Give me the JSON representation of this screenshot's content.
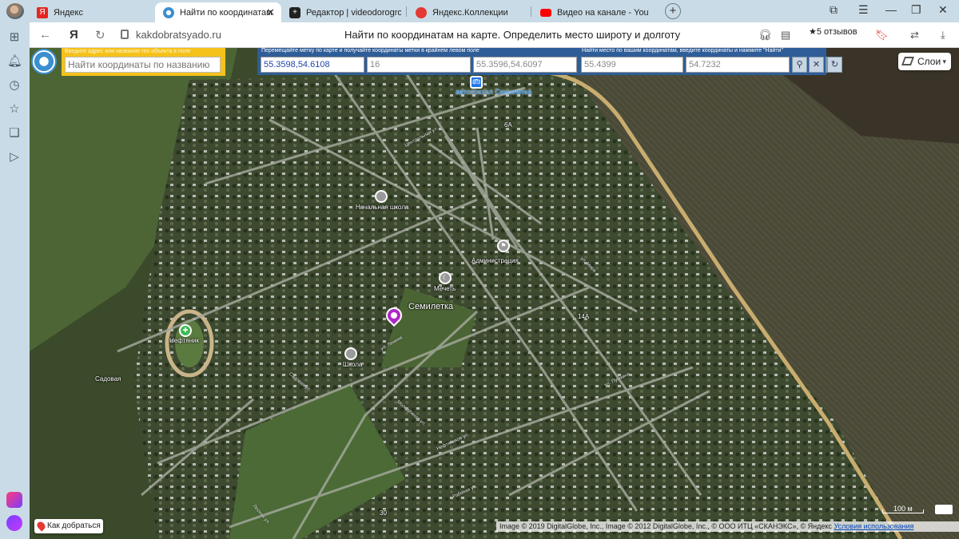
{
  "browser": {
    "tabs": [
      {
        "title": "Яндекс",
        "icon": "yandex-icon",
        "color": "#e52620"
      },
      {
        "title": "Найти по координатам",
        "icon": "globe-icon",
        "color": "#3b8fd0",
        "active": true
      },
      {
        "title": "Редактор | videodorogrosc",
        "icon": "editor-icon",
        "color": "#222222"
      },
      {
        "title": "Яндекс.Коллекции",
        "icon": "collections-icon",
        "color": "#e53935"
      },
      {
        "title": "Видео на канале - YouTube",
        "icon": "youtube-icon",
        "color": "#ff0000"
      }
    ],
    "url": "kakdobratsyado.ru",
    "page_title": "Найти по координатам на карте. Определить место широту и долготу",
    "reviews": "5 отзывов",
    "yandex_letter": "Я"
  },
  "app": {
    "search_hint": "Введите адрес или название гео объекта в поле",
    "search_placeholder": "Найти координаты по названию",
    "marker_caption": "Перемещайте метку по карте и получайте координаты метки в крайнем левом поле",
    "find_caption": "Найти место по вашим координатам, введите координаты и нажмите \"Найти\"",
    "marker_coords": "55.3598,54.6108",
    "zoom": "16",
    "corner_coords": "55.3596,54.6097",
    "lat_input": "55.4399",
    "lon_input": "54.7232",
    "layers_label": "Слои",
    "route_label": "Как добраться",
    "scale_label": "100 м",
    "copyright": "Image © 2019 DigitalGlobe, Inc., Image © 2012 DigitalGlobe, Inc., © ООО ИТЦ «СКАНЭКС», © Яндекс",
    "terms_link": "Условия использования"
  },
  "map_labels": {
    "bus_station": "автовокзал Семилетка",
    "primary_school": "Начальная школа",
    "administration": "Администрация",
    "mosque": "Мечеть",
    "village": "Семилетка",
    "neftyanik": "Нефтяник",
    "school": "Школа",
    "sadovaya": "Садовая",
    "street_lenina": "ул. Ленина",
    "street_sadovaya": "Садовая ул.",
    "street_molodezhnaya": "Молодёжная ул.",
    "street_lesnaya": "Лесная ул.",
    "street_rabochaya": "Рабочая ул.",
    "street_neftyanikov": "Нефтяников ул.",
    "street_central": "Центральная ул.",
    "street_mira": "ул. Мира",
    "street_pushkina": "ул. Пушкина",
    "house_6a": "6А",
    "house_14a": "14А",
    "house_30": "30"
  },
  "colors": {
    "tabstrip": "#c9dbe6",
    "panel_blue": "#2f5d98",
    "search_yellow": "#f5c21b",
    "marker": "#b027c7"
  }
}
